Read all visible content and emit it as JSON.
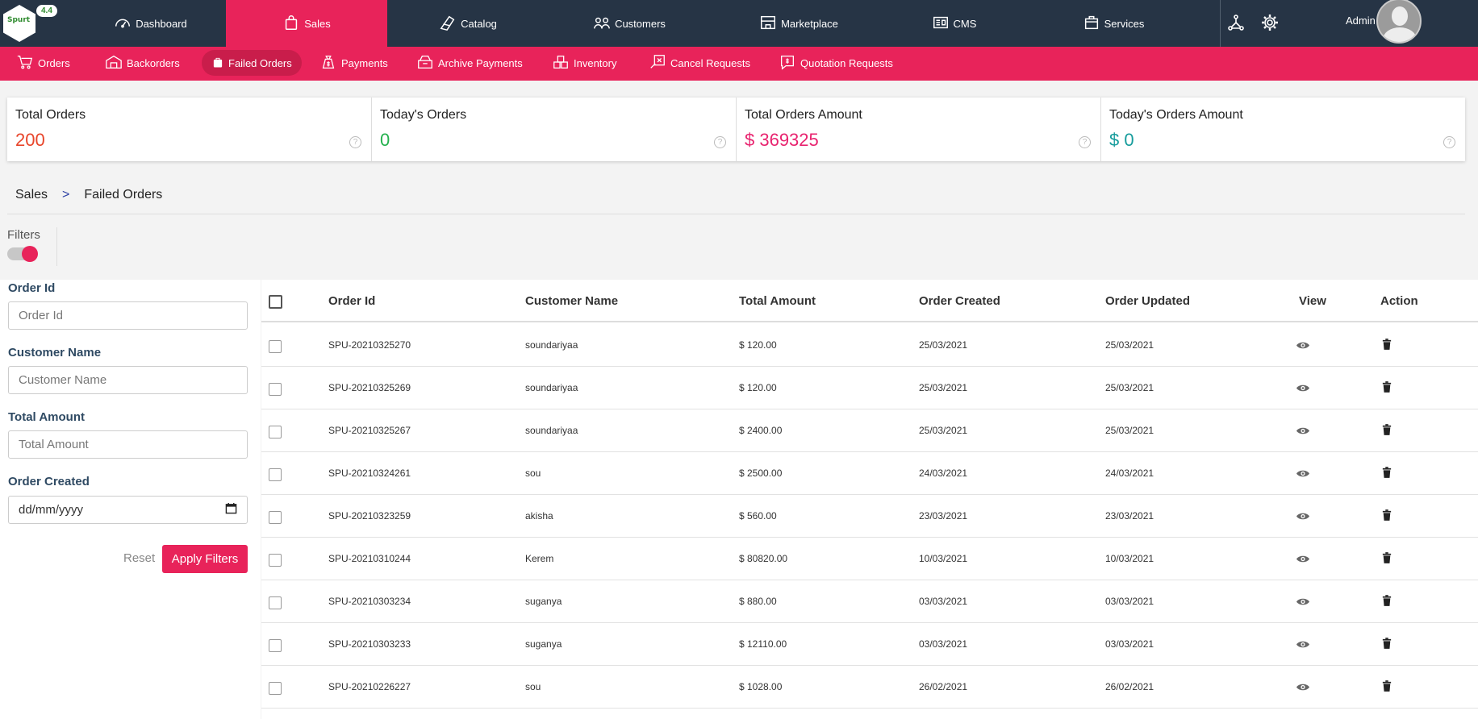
{
  "app": {
    "logo_text": "Spurt",
    "version": "4.4"
  },
  "topnav": {
    "items": [
      {
        "label": "Dashboard",
        "icon": "speedometer-icon"
      },
      {
        "label": "Sales",
        "icon": "shopping-bag-icon",
        "active": true
      },
      {
        "label": "Catalog",
        "icon": "tags-icon"
      },
      {
        "label": "Customers",
        "icon": "users-icon"
      },
      {
        "label": "Marketplace",
        "icon": "store-icon"
      },
      {
        "label": "CMS",
        "icon": "document-icon"
      },
      {
        "label": "Services",
        "icon": "services-icon"
      }
    ],
    "admin_label": "Admin"
  },
  "subnav": {
    "items": [
      {
        "label": "Orders"
      },
      {
        "label": "Backorders"
      },
      {
        "label": "Failed Orders",
        "active": true
      },
      {
        "label": "Payments"
      },
      {
        "label": "Archive Payments"
      },
      {
        "label": "Inventory"
      },
      {
        "label": "Cancel Requests"
      },
      {
        "label": "Quotation Requests"
      }
    ]
  },
  "stats": [
    {
      "label": "Total Orders",
      "value": "200",
      "color": "#e8452a"
    },
    {
      "label": "Today's Orders",
      "value": "0",
      "color": "#23b14d"
    },
    {
      "label": "Total Orders Amount",
      "value": "$ 369325",
      "color": "#e8236f"
    },
    {
      "label": "Today's Orders Amount",
      "value": "$ 0",
      "color": "#169c9c"
    }
  ],
  "breadcrumb": {
    "root": "Sales",
    "separator": ">",
    "current": "Failed Orders"
  },
  "filters": {
    "title": "Filters",
    "order_id": {
      "label": "Order Id",
      "placeholder": "Order Id"
    },
    "customer_name": {
      "label": "Customer Name",
      "placeholder": "Customer Name"
    },
    "total_amount": {
      "label": "Total Amount",
      "placeholder": "Total Amount"
    },
    "order_created": {
      "label": "Order Created",
      "placeholder": "dd/mm/yyyy"
    },
    "reset_label": "Reset",
    "apply_label": "Apply Filters"
  },
  "table": {
    "headers": [
      "Order Id",
      "Customer Name",
      "Total Amount",
      "Order Created",
      "Order Updated",
      "View",
      "Action"
    ],
    "rows": [
      {
        "order_id": "SPU-20210325270",
        "customer": "soundariyaa",
        "amount": "$ 120.00",
        "created": "25/03/2021",
        "updated": "25/03/2021"
      },
      {
        "order_id": "SPU-20210325269",
        "customer": "soundariyaa",
        "amount": "$ 120.00",
        "created": "25/03/2021",
        "updated": "25/03/2021"
      },
      {
        "order_id": "SPU-20210325267",
        "customer": "soundariyaa",
        "amount": "$ 2400.00",
        "created": "25/03/2021",
        "updated": "25/03/2021"
      },
      {
        "order_id": "SPU-20210324261",
        "customer": "sou",
        "amount": "$ 2500.00",
        "created": "24/03/2021",
        "updated": "24/03/2021"
      },
      {
        "order_id": "SPU-20210323259",
        "customer": "akisha",
        "amount": "$ 560.00",
        "created": "23/03/2021",
        "updated": "23/03/2021"
      },
      {
        "order_id": "SPU-20210310244",
        "customer": "Kerem",
        "amount": "$ 80820.00",
        "created": "10/03/2021",
        "updated": "10/03/2021"
      },
      {
        "order_id": "SPU-20210303234",
        "customer": "suganya",
        "amount": "$ 880.00",
        "created": "03/03/2021",
        "updated": "03/03/2021"
      },
      {
        "order_id": "SPU-20210303233",
        "customer": "suganya",
        "amount": "$ 12110.00",
        "created": "03/03/2021",
        "updated": "03/03/2021"
      },
      {
        "order_id": "SPU-20210226227",
        "customer": "sou",
        "amount": "$ 1028.00",
        "created": "26/02/2021",
        "updated": "26/02/2021"
      }
    ]
  }
}
